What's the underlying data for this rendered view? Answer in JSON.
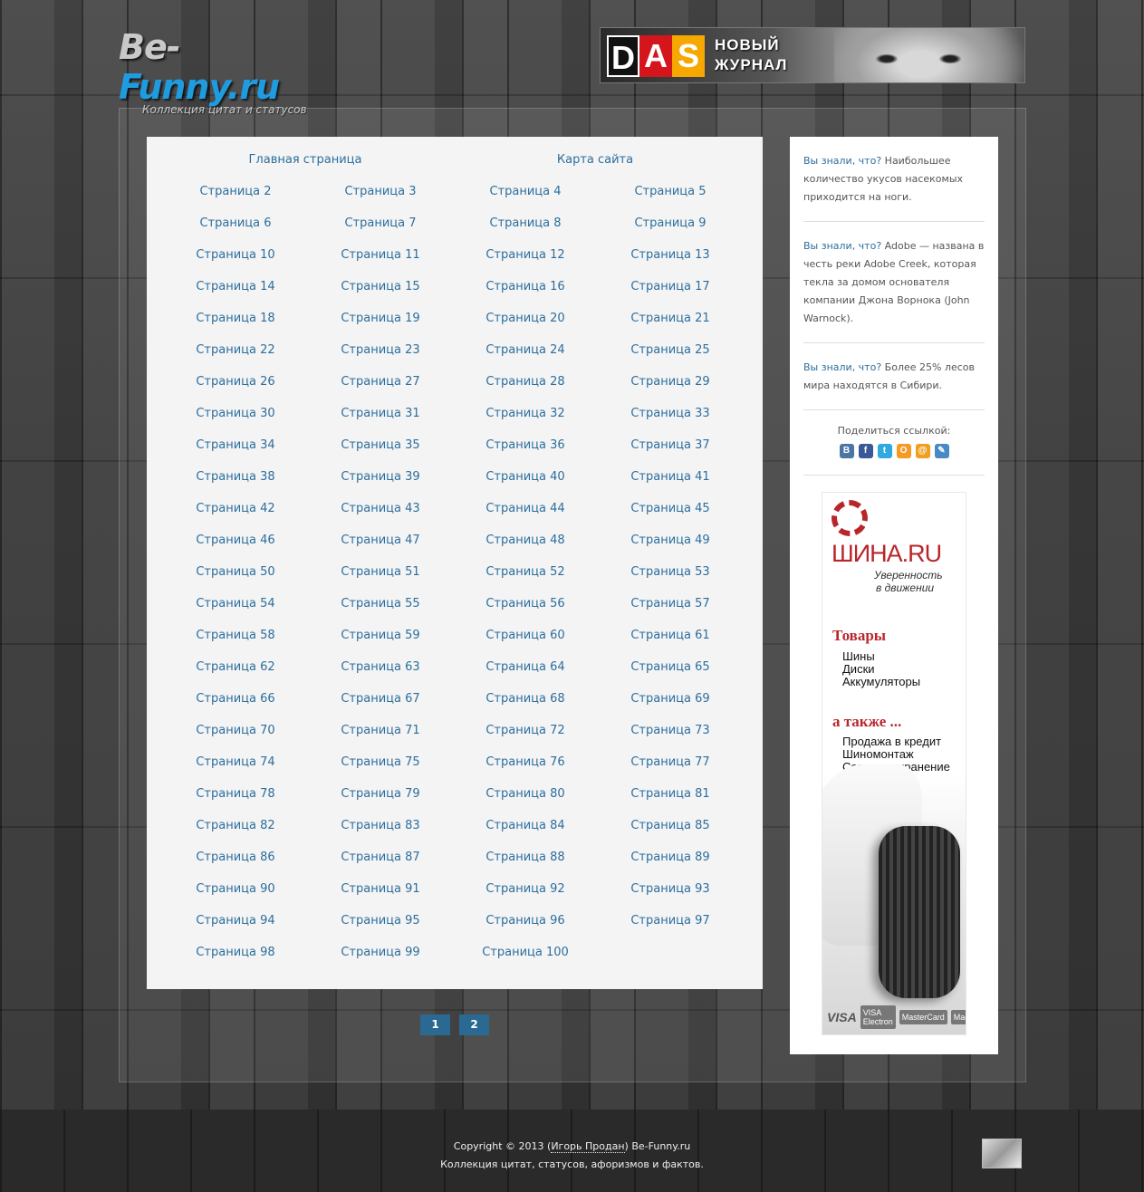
{
  "header": {
    "logo_part1": "Be-",
    "logo_part2": "Funny.ru",
    "tagline": "Коллекция цитат и статусов",
    "banner": {
      "d": "D",
      "a": "A",
      "s": "S",
      "line1": "НОВЫЙ",
      "line2": "ЖУРНАЛ"
    }
  },
  "content": {
    "main_link": "Главная страница",
    "sitemap_link": "Карта сайта",
    "pages": [
      "Страница 2",
      "Страница 3",
      "Страница 4",
      "Страница 5",
      "Страница 6",
      "Страница 7",
      "Страница 8",
      "Страница 9",
      "Страница 10",
      "Страница 11",
      "Страница 12",
      "Страница 13",
      "Страница 14",
      "Страница 15",
      "Страница 16",
      "Страница 17",
      "Страница 18",
      "Страница 19",
      "Страница 20",
      "Страница 21",
      "Страница 22",
      "Страница 23",
      "Страница 24",
      "Страница 25",
      "Страница 26",
      "Страница 27",
      "Страница 28",
      "Страница 29",
      "Страница 30",
      "Страница 31",
      "Страница 32",
      "Страница 33",
      "Страница 34",
      "Страница 35",
      "Страница 36",
      "Страница 37",
      "Страница 38",
      "Страница 39",
      "Страница 40",
      "Страница 41",
      "Страница 42",
      "Страница 43",
      "Страница 44",
      "Страница 45",
      "Страница 46",
      "Страница 47",
      "Страница 48",
      "Страница 49",
      "Страница 50",
      "Страница 51",
      "Страница 52",
      "Страница 53",
      "Страница 54",
      "Страница 55",
      "Страница 56",
      "Страница 57",
      "Страница 58",
      "Страница 59",
      "Страница 60",
      "Страница 61",
      "Страница 62",
      "Страница 63",
      "Страница 64",
      "Страница 65",
      "Страница 66",
      "Страница 67",
      "Страница 68",
      "Страница 69",
      "Страница 70",
      "Страница 71",
      "Страница 72",
      "Страница 73",
      "Страница 74",
      "Страница 75",
      "Страница 76",
      "Страница 77",
      "Страница 78",
      "Страница 79",
      "Страница 80",
      "Страница 81",
      "Страница 82",
      "Страница 83",
      "Страница 84",
      "Страница 85",
      "Страница 86",
      "Страница 87",
      "Страница 88",
      "Страница 89",
      "Страница 90",
      "Страница 91",
      "Страница 92",
      "Страница 93",
      "Страница 94",
      "Страница 95",
      "Страница 96",
      "Страница 97",
      "Страница 98",
      "Страница 99",
      "Страница 100"
    ]
  },
  "pager": [
    "1",
    "2"
  ],
  "sidebar": {
    "facts": [
      {
        "q": "Вы знали, что?",
        "text": " Наибольшее количество укусов насекомых приходится на ноги."
      },
      {
        "q": "Вы знали, что?",
        "text": " Adobe — названа в честь реки Adobe Creek, которая текла за домом основателя компании Джона Ворнока (John Warnock)."
      },
      {
        "q": "Вы знали, что?",
        "text": " Более 25% лесов мира находятся в Сибири."
      }
    ],
    "share_label": "Поделиться ссылкой:",
    "share_icons": [
      {
        "name": "vkontakte-icon",
        "glyph": "В",
        "color": "#4c75a3"
      },
      {
        "name": "facebook-icon",
        "glyph": "f",
        "color": "#3b5998"
      },
      {
        "name": "twitter-icon",
        "glyph": "t",
        "color": "#2fa9e0"
      },
      {
        "name": "odnoklassniki-icon",
        "glyph": "О",
        "color": "#f59a22"
      },
      {
        "name": "mailru-icon",
        "glyph": "@",
        "color": "#f0a020"
      },
      {
        "name": "livejournal-icon",
        "glyph": "✎",
        "color": "#4a8ac4"
      }
    ],
    "ad": {
      "brand": "ШИНА.RU",
      "slogan1": "Уверенность",
      "slogan2": "в  движении",
      "goods_title": "Товары",
      "goods": [
        "Шины",
        "Диски",
        "Аккумуляторы"
      ],
      "also_title": "а также ...",
      "also": [
        "Продажа в кредит",
        "Шиномонтаж",
        "Сезонное хранение"
      ],
      "cards": [
        "VISA",
        "VISA Electron",
        "MasterCard",
        "Maestro"
      ]
    }
  },
  "footer": {
    "copyright_prefix": "Copyright © 2013 (",
    "author": "Игорь Продан",
    "copyright_suffix": ") Be-Funny.ru",
    "line2": "Коллекция цитат, статусов, афоризмов и фактов."
  }
}
